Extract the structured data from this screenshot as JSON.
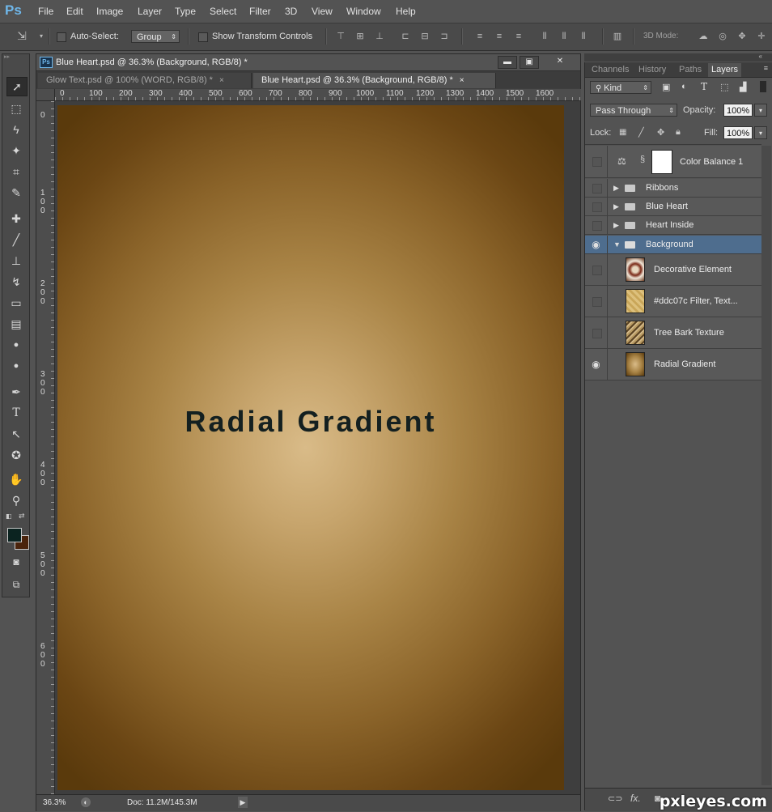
{
  "app": {
    "logo": "Ps",
    "menus": [
      "File",
      "Edit",
      "Image",
      "Layer",
      "Type",
      "Select",
      "Filter",
      "3D",
      "View",
      "Window",
      "Help"
    ]
  },
  "options_bar": {
    "auto_select_label": "Auto-Select:",
    "auto_select_value": "Group",
    "transform_label": "Show Transform Controls",
    "mode_label": "3D Mode:"
  },
  "document": {
    "window_title": "Blue Heart.psd @ 36.3% (Background, RGB/8) *",
    "tabs": [
      {
        "label": "Glow Text.psd @ 100% (WORD, RGB/8) *",
        "close": "×"
      },
      {
        "label": "Blue Heart.psd @ 36.3% (Background, RGB/8) *",
        "close": "×"
      }
    ],
    "window_buttons": {
      "minimize": "▬",
      "restore": "▣",
      "close": "✕"
    },
    "ruler_h": [
      "0",
      "100",
      "200",
      "300",
      "400",
      "500",
      "600",
      "700",
      "800",
      "900",
      "1000",
      "1100",
      "1200",
      "1300",
      "1400",
      "1500",
      "1600"
    ],
    "ruler_v": [
      "0",
      "1\n0\n0",
      "2\n0\n0",
      "3\n0\n0",
      "4\n0\n0",
      "5\n0\n0",
      "6\n0\n0"
    ],
    "canvas_text": "Radial Gradient",
    "canvas_colors": {
      "center": "#d9bb88",
      "edge": "#5a3a0c",
      "text": "#142020"
    },
    "zoom": "36.3%",
    "doc_size": "Doc: 11.2M/145.3M"
  },
  "tools": [
    "move-icon",
    "marquee-icon",
    "lasso-icon",
    "magic-wand-icon",
    "crop-icon",
    "eyedropper-icon",
    "healing-icon",
    "brush-icon",
    "stamp-icon",
    "history-brush-icon",
    "eraser-icon",
    "gradient-icon",
    "blur-icon",
    "dodge-icon",
    "pen-icon",
    "type-icon",
    "path-select-icon",
    "shape-icon",
    "hand-icon",
    "zoom-icon"
  ],
  "tool_glyphs": [
    "➚",
    "⬚",
    "ϟ",
    "✦",
    "⌗",
    "✎",
    "✚",
    "╱",
    "⊥",
    "↯",
    "▭",
    "▤",
    "●",
    "●",
    "✒",
    "T",
    "↖",
    "✪",
    "✋",
    "⚲"
  ],
  "swatches": {
    "foreground": "#0b2320",
    "background": "#4a240c"
  },
  "panel": {
    "tabs": [
      "Channels",
      "History",
      "Paths",
      "Layers"
    ],
    "active_tab": "Layers",
    "kind_label": "Kind",
    "blend_mode": "Pass Through",
    "opacity_label": "Opacity:",
    "opacity_value": "100%",
    "lock_label": "Lock:",
    "fill_label": "Fill:",
    "fill_value": "100%",
    "layers": [
      {
        "name": "Color Balance 1",
        "type": "adjustment",
        "visible": false
      },
      {
        "name": "Ribbons",
        "type": "group",
        "visible": false
      },
      {
        "name": "Blue Heart",
        "type": "group",
        "visible": false
      },
      {
        "name": "Heart Inside",
        "type": "group",
        "visible": false
      },
      {
        "name": "Background",
        "type": "group-open",
        "visible": true,
        "selected": true
      },
      {
        "name": "Decorative Element",
        "type": "image",
        "visible": false
      },
      {
        "name": "#ddc07c  Filter, Text...",
        "type": "image",
        "visible": false
      },
      {
        "name": "Tree Bark Texture",
        "type": "image",
        "visible": false
      },
      {
        "name": "Radial Gradient",
        "type": "image",
        "visible": true
      }
    ],
    "bottom_icons": [
      "link-icon",
      "fx-icon",
      "mask-icon"
    ],
    "bottom_glyphs": [
      "⊂⊃",
      "fx.",
      "◙"
    ]
  },
  "watermark": "pxleyes.com"
}
